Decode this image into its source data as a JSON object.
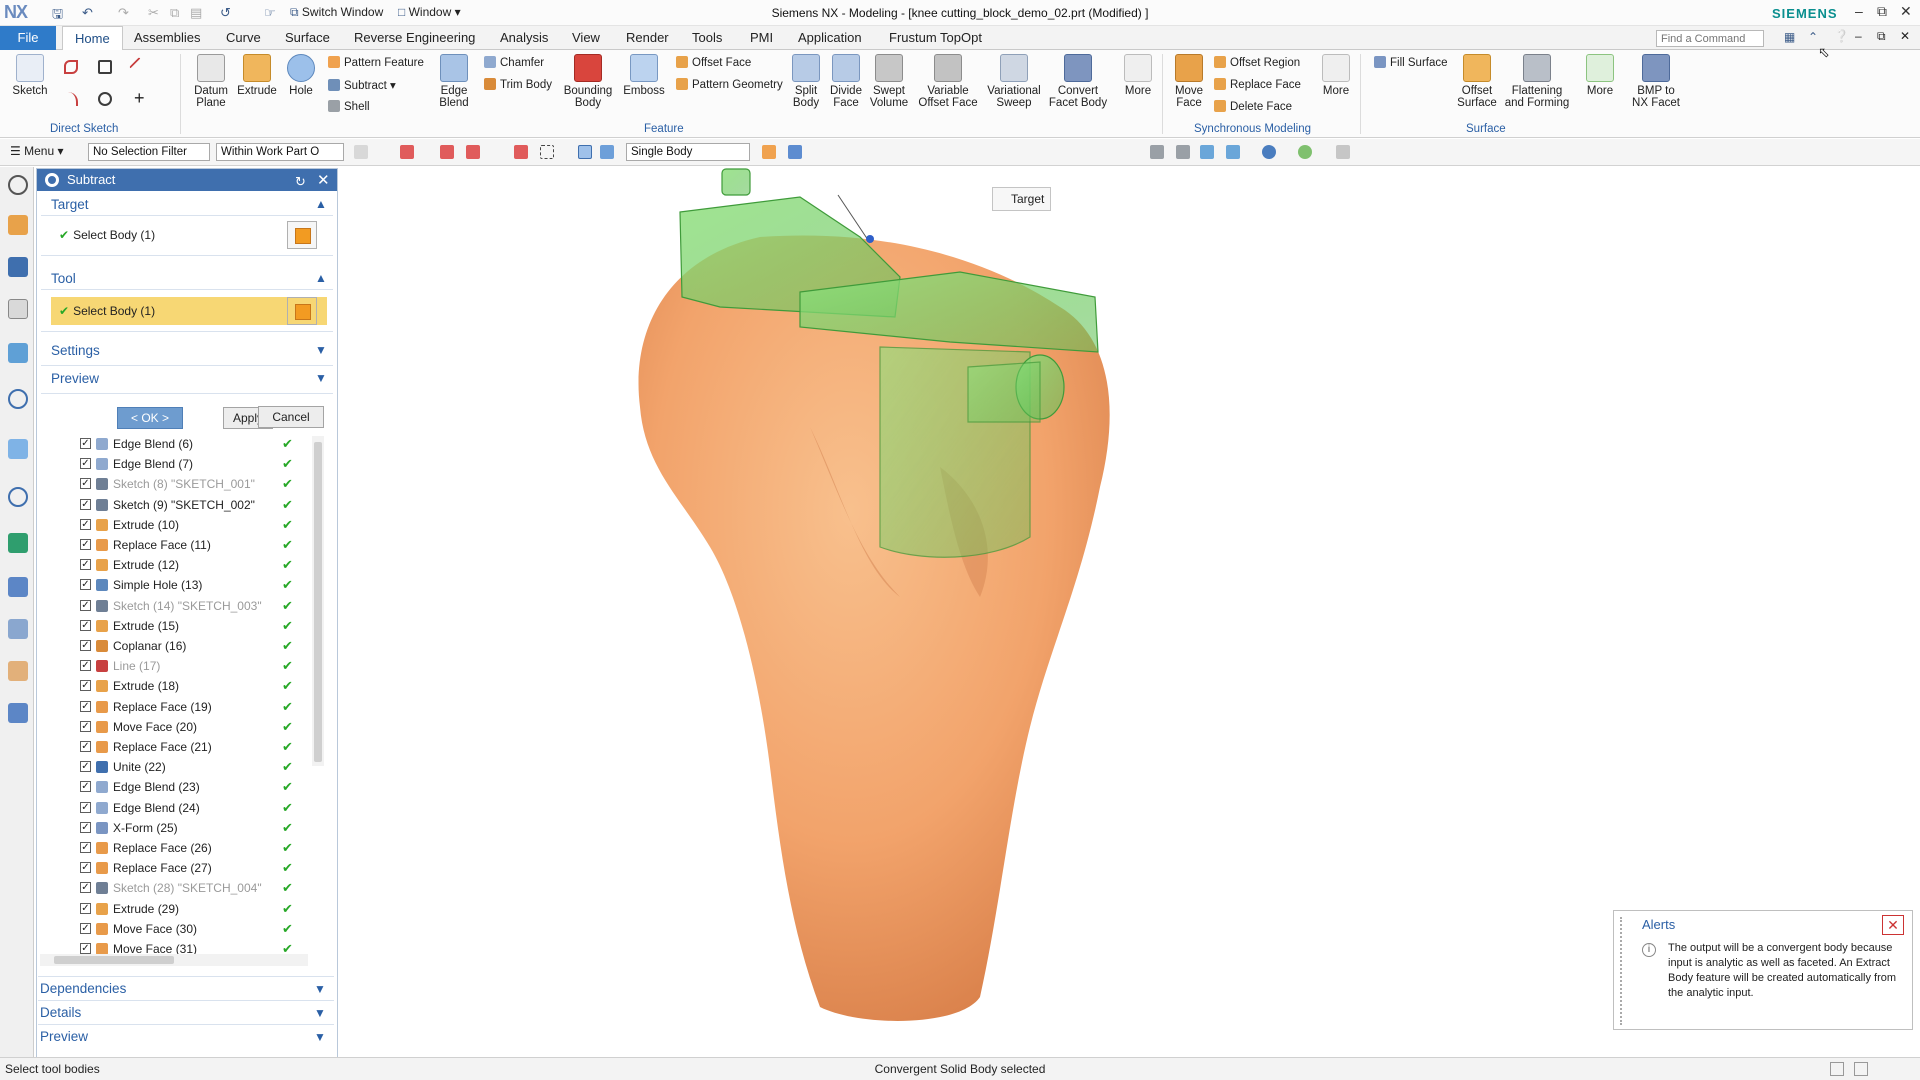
{
  "window": {
    "app_logo": "NX",
    "title": "Siemens NX - Modeling - [knee cutting_block_demo_02.prt (Modified) ]",
    "brand": "SIEMENS",
    "switch_window": "Switch Window",
    "window_menu": "Window"
  },
  "menu_tabs": [
    "File",
    "Home",
    "Assemblies",
    "Curve",
    "Surface",
    "Reverse Engineering",
    "Analysis",
    "View",
    "Render",
    "Tools",
    "PMI",
    "Application",
    "Frustum TopOpt"
  ],
  "active_tab": "Home",
  "command_search": {
    "placeholder": "Find a Command"
  },
  "ribbon": {
    "groups": {
      "direct_sketch": "Direct Sketch",
      "feature": "Feature",
      "synchronous_modeling": "Synchronous Modeling",
      "surface": "Surface"
    },
    "sketch": "Sketch",
    "datum_plane": "Datum Plane",
    "extrude": "Extrude",
    "hole": "Hole",
    "pattern_feature": "Pattern Feature",
    "subtract": "Subtract",
    "shell": "Shell",
    "edge_blend": "Edge Blend",
    "chamfer": "Chamfer",
    "trim_body": "Trim Body",
    "bounding_body": "Bounding Body",
    "emboss": "Emboss",
    "offset_face": "Offset Face",
    "pattern_geometry": "Pattern Geometry",
    "split_body": "Split Body",
    "divide_face": "Divide Face",
    "swept_volume": "Swept Volume",
    "variable_offset_face": "Variable Offset Face",
    "variational_sweep": "Variational Sweep",
    "convert_facet_body": "Convert Facet Body",
    "more": "More",
    "move_face": "Move Face",
    "offset_region": "Offset Region",
    "replace_face": "Replace Face",
    "delete_face": "Delete Face",
    "fill_surface": "Fill Surface",
    "offset_surface": "Offset Surface",
    "flattening_forming": "Flattening and Forming",
    "bmp_to_nx_facet": "BMP to NX Facet"
  },
  "selection_bar": {
    "menu": "Menu",
    "selection_filter": "No Selection Filter",
    "scope": "Within Work Part O",
    "body_mode": "Single Body"
  },
  "dialog": {
    "title": "Subtract",
    "target": {
      "title": "Target",
      "select": "Select Body (1)"
    },
    "tool": {
      "title": "Tool",
      "select": "Select Body (1)"
    },
    "settings": "Settings",
    "preview": "Preview",
    "ok": "< OK >",
    "apply": "Apply",
    "cancel": "Cancel"
  },
  "part_navigator": [
    {
      "label": "Edge Blend (6)",
      "icon": "edge-blend",
      "dim": false
    },
    {
      "label": "Edge Blend (7)",
      "icon": "edge-blend",
      "dim": false
    },
    {
      "label": "Sketch (8) \"SKETCH_001\"",
      "icon": "sketch",
      "dim": true
    },
    {
      "label": "Sketch (9) \"SKETCH_002\"",
      "icon": "sketch",
      "dim": false
    },
    {
      "label": "Extrude (10)",
      "icon": "extrude",
      "dim": false
    },
    {
      "label": "Replace Face (11)",
      "icon": "replace-face",
      "dim": false
    },
    {
      "label": "Extrude (12)",
      "icon": "extrude",
      "dim": false
    },
    {
      "label": "Simple Hole (13)",
      "icon": "hole",
      "dim": false
    },
    {
      "label": "Sketch (14) \"SKETCH_003\"",
      "icon": "sketch",
      "dim": true
    },
    {
      "label": "Extrude (15)",
      "icon": "extrude",
      "dim": false
    },
    {
      "label": "Coplanar (16)",
      "icon": "coplanar",
      "dim": false
    },
    {
      "label": "Line (17)",
      "icon": "line",
      "dim": true
    },
    {
      "label": "Extrude (18)",
      "icon": "extrude",
      "dim": false
    },
    {
      "label": "Replace Face (19)",
      "icon": "replace-face",
      "dim": false
    },
    {
      "label": "Move Face (20)",
      "icon": "move-face",
      "dim": false
    },
    {
      "label": "Replace Face (21)",
      "icon": "replace-face",
      "dim": false
    },
    {
      "label": "Unite (22)",
      "icon": "unite",
      "dim": false
    },
    {
      "label": "Edge Blend (23)",
      "icon": "edge-blend",
      "dim": false
    },
    {
      "label": "Edge Blend (24)",
      "icon": "edge-blend",
      "dim": false
    },
    {
      "label": "X-Form (25)",
      "icon": "x-form",
      "dim": false
    },
    {
      "label": "Replace Face (26)",
      "icon": "replace-face",
      "dim": false
    },
    {
      "label": "Replace Face (27)",
      "icon": "replace-face",
      "dim": false
    },
    {
      "label": "Sketch (28) \"SKETCH_004\"",
      "icon": "sketch",
      "dim": true
    },
    {
      "label": "Extrude (29)",
      "icon": "extrude",
      "dim": false
    },
    {
      "label": "Move Face (30)",
      "icon": "move-face",
      "dim": false
    },
    {
      "label": "Move Face (31)",
      "icon": "move-face",
      "dim": false
    }
  ],
  "navigator_sections": [
    "Dependencies",
    "Details",
    "Preview"
  ],
  "viewport": {
    "target_label": "Target"
  },
  "alerts": {
    "title": "Alerts",
    "message": "The output will be a convergent body because input is analytic as well as faceted. An Extract Body feature will be created automatically from the analytic input."
  },
  "status": {
    "left": "Select tool bodies",
    "center": "Convergent Solid Body selected"
  },
  "colors": {
    "accent": "#2f7bc9",
    "dialog_header": "#3f6fae",
    "tool_highlight": "#f7d774",
    "bone": "#f2a36b",
    "cutting_block": "#7ed36f"
  }
}
